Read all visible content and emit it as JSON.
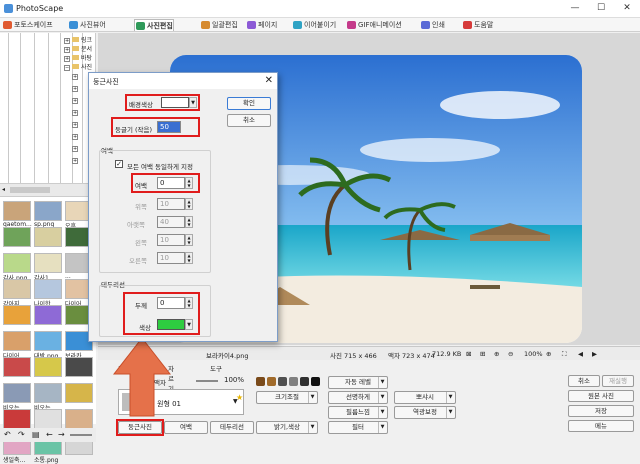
{
  "app": {
    "title": "PhotoScape"
  },
  "tabs": [
    {
      "label": "포토스케이프",
      "color": "#e05a30"
    },
    {
      "label": "사진뷰어",
      "color": "#3a8fd6"
    },
    {
      "label": "사진편집",
      "color": "#2f9a5a"
    },
    {
      "label": "일괄편집",
      "color": "#d68a2f"
    },
    {
      "label": "페이지",
      "color": "#8c5ad6"
    },
    {
      "label": "이어붙이기",
      "color": "#2fa3c4"
    },
    {
      "label": "GIF애니메이션",
      "color": "#c43a8a"
    },
    {
      "label": "인쇄",
      "color": "#5a6ad6"
    },
    {
      "label": "도움말",
      "color": "#d63a3a"
    }
  ],
  "tree": {
    "nodes": [
      "링크",
      "문서",
      "바탕",
      "사진"
    ]
  },
  "thumbs": [
    {
      "label": "qaetom...",
      "color": "#c9a47a"
    },
    {
      "label": "sp.png",
      "color": "#8aa6c9"
    },
    {
      "label": "오후...",
      "color": "#e8d6b8"
    },
    {
      "label": "",
      "color": "#6fa35a"
    },
    {
      "label": "",
      "color": "#d8cfa0"
    },
    {
      "label": "",
      "color": "#3f6b3a"
    },
    {
      "label": "감사.png",
      "color": "#b9d98a"
    },
    {
      "label": "감사1.",
      "color": "#e6e0c0"
    },
    {
      "label": "...",
      "color": "#c4c4c4"
    },
    {
      "label": "강아지...",
      "color": "#d9c7a6"
    },
    {
      "label": "나이한...",
      "color": "#b5c7de"
    },
    {
      "label": "다이어...",
      "color": "#e2c2a2"
    },
    {
      "label": "",
      "color": "#e8a23a"
    },
    {
      "label": "",
      "color": "#8e6ad6"
    },
    {
      "label": "",
      "color": "#6a8e3f"
    },
    {
      "label": "다이어...",
      "color": "#d9a06a"
    },
    {
      "label": "대박.png",
      "color": "#6ab1e2"
    },
    {
      "label": "보라카...",
      "color": "#3a8fd6"
    },
    {
      "label": "",
      "color": "#c94a4a"
    },
    {
      "label": "",
      "color": "#d6c84a"
    },
    {
      "label": "",
      "color": "#4a4a4a"
    },
    {
      "label": "비오는...",
      "color": "#8a9ab5"
    },
    {
      "label": "비오는...",
      "color": "#a6b5c4"
    },
    {
      "label": "",
      "color": "#d6b54a"
    },
    {
      "label": "",
      "color": "#c93a3a"
    },
    {
      "label": "",
      "color": "#e0e0e0"
    },
    {
      "label": "",
      "color": "#d9b08a"
    },
    {
      "label": "생일축...",
      "color": "#e2a6c4"
    },
    {
      "label": "소통.png",
      "color": "#6ac4a6"
    },
    {
      "label": "",
      "color": "#d6d6d6"
    }
  ],
  "status": {
    "filename": "보라카이4.png",
    "photo_size": "사진 715 x 466",
    "frame_size": "액자 723 x 474",
    "file_size": "712.9 KB",
    "zoom": "100%"
  },
  "panel": {
    "frame_zoom": "100%",
    "frame_name": "원형 01",
    "frame_label": "액자",
    "sub_tabs": [
      "홈",
      "자르기",
      "도구"
    ],
    "buttons": {
      "auto_level": "자동 레벨",
      "sharpen": "선명하게",
      "wash": "뽀샤시",
      "resize": "크기조절",
      "film": "필름느낌",
      "backlight": "역광보정",
      "brightness": "밝기,색상",
      "filter": "필터",
      "rounded": "둥근사진",
      "margin": "여백",
      "border": "테두리선",
      "undo": "취소",
      "redo": "재실행",
      "original": "원본 사진",
      "save": "저장",
      "menu": "메뉴"
    }
  },
  "dialog": {
    "title": "둥근사진",
    "bg_color_label": "배경색상",
    "roundness_label": "둥글기 (작음)",
    "roundness_value": "50",
    "ok": "확인",
    "cancel": "취소",
    "margin_group": "여백",
    "same_margin_checkbox": "모든 여백 동일하게 지정",
    "same_margin_checked": true,
    "margin_label": "여백",
    "margin_value": "0",
    "top_label": "위쪽",
    "top_value": "10",
    "bottom_label": "아랫쪽",
    "bottom_value": "40",
    "left_label": "왼쪽",
    "left_value": "10",
    "right_label": "오른쪽",
    "right_value": "10",
    "border_group": "테두리선",
    "thickness_label": "두께",
    "thickness_value": "0",
    "color_label": "색상",
    "bg_color": "#ffffff",
    "border_color": "#2ecc40"
  }
}
